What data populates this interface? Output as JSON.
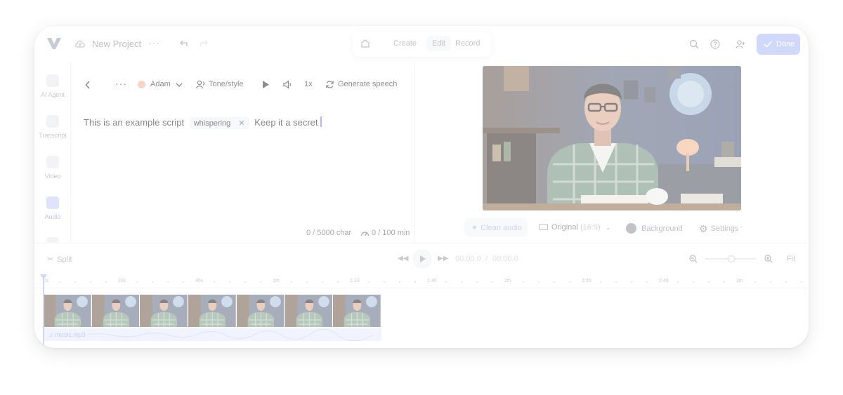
{
  "header": {
    "project_title": "New Project",
    "modes": [
      "Create",
      "Edit",
      "Record"
    ],
    "active_mode": "Edit",
    "done_label": "Done",
    "icons": [
      "logo-icon",
      "cloud-icon",
      "more-icon",
      "undo-icon",
      "redo-icon",
      "home-icon",
      "search-icon",
      "help-icon",
      "add-user-icon",
      "check-icon"
    ]
  },
  "sidebar": {
    "items": [
      {
        "label": "AI Agent",
        "icon": "sparkle-icon"
      },
      {
        "label": "Transcript",
        "icon": "transcript-icon"
      },
      {
        "label": "Video",
        "icon": "video-icon"
      },
      {
        "label": "Audio",
        "icon": "music-icon"
      }
    ],
    "active": "Audio"
  },
  "script_panel": {
    "voice": "Adam",
    "tone_label": "Tone/style",
    "speed": "1x",
    "generate_label": "Generate speech",
    "script_before": "This is an example script",
    "tag": "whispering",
    "script_after": "Keep it a secret",
    "char_counter": "0 / 5000 char",
    "min_counter": "0 / 100 min"
  },
  "preview": {
    "clean_audio_label": "Clean audio",
    "aspect_label": "Original",
    "aspect_ratio": "(16:9)",
    "background_label": "Background",
    "settings_label": "Settings"
  },
  "timeline": {
    "split_label": "Split",
    "current_time": "00:00.0",
    "separator": "/",
    "total_time": "00:00.0",
    "fit_label": "Fit",
    "zoom_level": 0.5,
    "ruler_labels": [
      "0s",
      "20s",
      "40s",
      "1m",
      "1:20",
      "1:40",
      "2m",
      "2:20",
      "2:40",
      "3m"
    ],
    "audio_track_label": "music.mp3"
  },
  "colors": {
    "accent": "#a9b8f7",
    "accent_text": "#8f9be8",
    "audio_track": "#e6ecfd"
  }
}
